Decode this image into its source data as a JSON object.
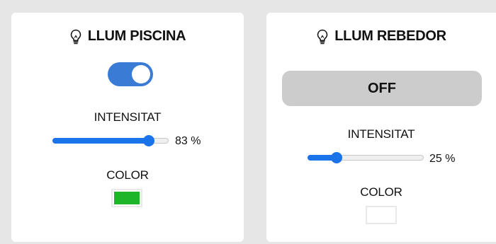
{
  "panels": [
    {
      "title": "LLUM PISCINA",
      "icon": "lightbulb-icon",
      "toggle_on": true,
      "intensity_label": "INTENSITAT",
      "intensity_value": 83,
      "intensity_text": "83 %",
      "color_label": "COLOR",
      "color_value": "#1fb52b"
    },
    {
      "title": "LLUM REBEDOR",
      "icon": "lightbulb-icon",
      "state_button": "OFF",
      "intensity_label": "INTENSITAT",
      "intensity_value": 25,
      "intensity_text": "25 %",
      "color_label": "COLOR",
      "color_value": "#ffffff"
    }
  ],
  "colors": {
    "accent": "#1a73e8",
    "toggle": "#3a7bd5",
    "off_button": "#cccccc",
    "background": "#e6e6e6"
  }
}
